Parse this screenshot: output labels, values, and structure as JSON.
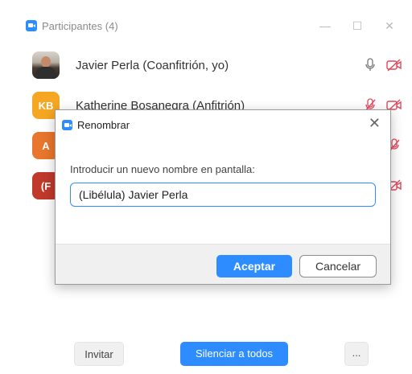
{
  "window": {
    "title": "Participantes (4)",
    "minimize_glyph": "—",
    "maximize_glyph": "☐",
    "close_glyph": "✕"
  },
  "participants": [
    {
      "initials": "",
      "name": "Javier Perla (Coanfitrión, yo)",
      "avatar_color": "#5a4a40"
    },
    {
      "initials": "KB",
      "name": "Katherine Bosanegra (Anfitrión)",
      "avatar_color": "#f5a623"
    },
    {
      "initials": "A",
      "name": "",
      "avatar_color": "#e8762c"
    },
    {
      "initials": "(F",
      "name": "",
      "avatar_color": "#c0392b"
    }
  ],
  "bottom": {
    "invite_label": "Invitar",
    "mute_all_label": "Silenciar a todos",
    "more_label": "..."
  },
  "dialog": {
    "title": "Renombrar",
    "close_glyph": "✕",
    "prompt_label": "Introducir un nuevo nombre en pantalla:",
    "input_value": "(Libélula) Javier Perla",
    "accept_label": "Aceptar",
    "cancel_label": "Cancelar"
  },
  "colors": {
    "accent": "#2d8cff",
    "muted_icon": "#e0475b"
  }
}
